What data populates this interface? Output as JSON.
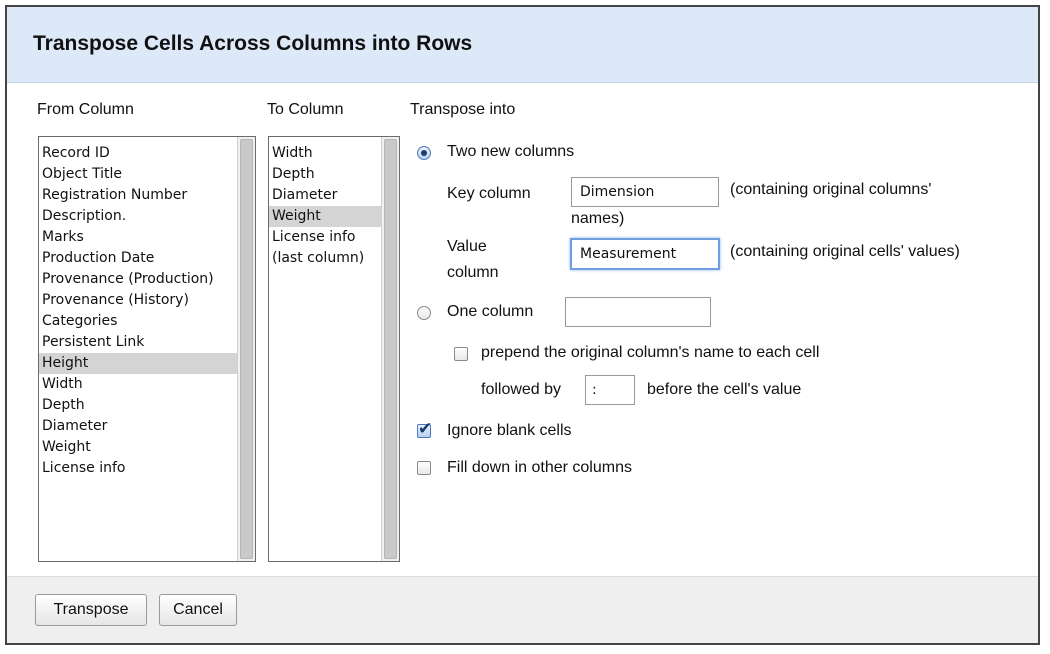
{
  "dialog": {
    "title": "Transpose Cells Across Columns into Rows"
  },
  "from_column": {
    "label": "From Column",
    "items": [
      {
        "label": "Record ID",
        "selected": false
      },
      {
        "label": "Object Title",
        "selected": false
      },
      {
        "label": "Registration Number",
        "selected": false
      },
      {
        "label": "Description.",
        "selected": false
      },
      {
        "label": "Marks",
        "selected": false
      },
      {
        "label": "Production Date",
        "selected": false
      },
      {
        "label": "Provenance (Production)",
        "selected": false
      },
      {
        "label": "Provenance (History)",
        "selected": false
      },
      {
        "label": "Categories",
        "selected": false
      },
      {
        "label": "Persistent Link",
        "selected": false
      },
      {
        "label": "Height",
        "selected": true
      },
      {
        "label": "Width",
        "selected": false
      },
      {
        "label": "Depth",
        "selected": false
      },
      {
        "label": "Diameter",
        "selected": false
      },
      {
        "label": "Weight",
        "selected": false
      },
      {
        "label": "License info",
        "selected": false
      }
    ]
  },
  "to_column": {
    "label": "To Column",
    "items": [
      {
        "label": "Width",
        "selected": false
      },
      {
        "label": "Depth",
        "selected": false
      },
      {
        "label": "Diameter",
        "selected": false
      },
      {
        "label": "Weight",
        "selected": true
      },
      {
        "label": "License info",
        "selected": false
      },
      {
        "label": "(last column)",
        "selected": false
      }
    ]
  },
  "transpose_into": {
    "label": "Transpose into",
    "two_new_columns": {
      "label": "Two new columns",
      "checked": true,
      "key_column_label": "Key column",
      "key_column_value": "Dimension",
      "key_column_note_line1": "(containing original columns'",
      "key_column_note_line2": "names)",
      "value_column_label_line1": "Value",
      "value_column_label_line2": "column",
      "value_column_value": "Measurement",
      "value_column_note": "(containing original cells' values)"
    },
    "one_column": {
      "label": "One column",
      "checked": false,
      "value": ""
    },
    "prepend": {
      "label": "prepend the original column's name to each cell",
      "checked": false,
      "followed_by_label": "followed by",
      "separator_value": ":",
      "after_label": "before the cell's value"
    },
    "ignore_blank": {
      "label": "Ignore blank cells",
      "checked": true
    },
    "fill_down": {
      "label": "Fill down in other columns",
      "checked": false
    }
  },
  "footer": {
    "transpose_label": "Transpose",
    "cancel_label": "Cancel"
  }
}
